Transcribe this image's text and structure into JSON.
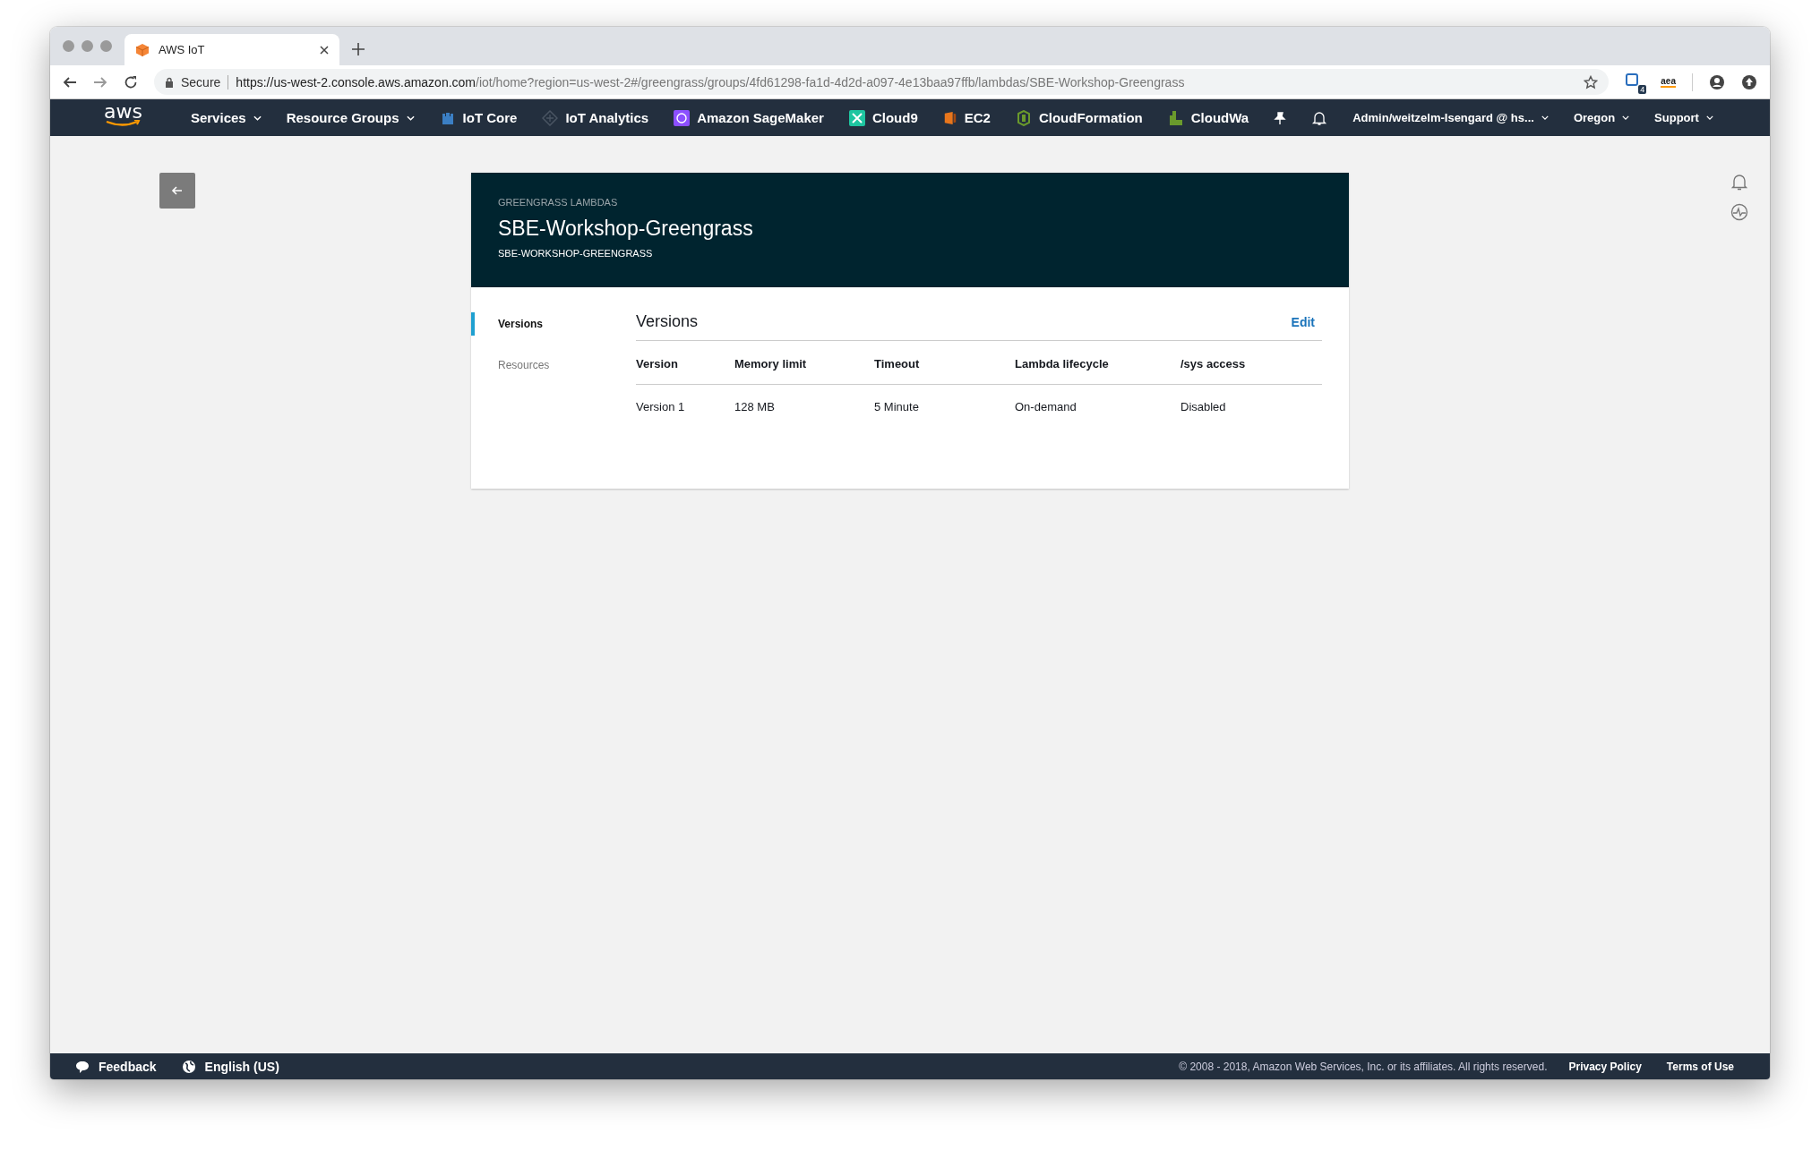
{
  "browser": {
    "tab_title": "AWS IoT",
    "secure_label": "Secure",
    "url_host": "https://us-west-2.console.aws.amazon.com",
    "url_path": "/iot/home?region=us-west-2#/greengrass/groups/4fd61298-fa1d-4d2d-a097-4e13baa97ffb/lambdas/SBE-Workshop-Greengrass",
    "extension_badge": "4",
    "extension_label": "aea"
  },
  "nav": {
    "logo": "aws",
    "menus": [
      {
        "label": "Services"
      },
      {
        "label": "Resource Groups"
      }
    ],
    "shortcuts": [
      {
        "label": "IoT Core",
        "kind": "iot-core"
      },
      {
        "label": "IoT Analytics",
        "kind": "iot-analytics"
      },
      {
        "label": "Amazon SageMaker",
        "kind": "sagemaker"
      },
      {
        "label": "Cloud9",
        "kind": "cloud9"
      },
      {
        "label": "EC2",
        "kind": "ec2"
      },
      {
        "label": "CloudFormation",
        "kind": "cloudformation"
      },
      {
        "label": "CloudWa",
        "kind": "cloudwatch"
      }
    ],
    "account": "Admin/weitzelm-Isengard @ hs...",
    "region": "Oregon",
    "support": "Support"
  },
  "header": {
    "eyebrow": "GREENGRASS LAMBDAS",
    "title": "SBE-Workshop-Greengrass",
    "subtitle": "SBE-WORKSHOP-GREENGRASS"
  },
  "tabs": [
    {
      "label": "Versions",
      "selected": true
    },
    {
      "label": "Resources",
      "selected": false
    }
  ],
  "section": {
    "title": "Versions",
    "action": "Edit"
  },
  "table": {
    "columns": [
      "Version",
      "Memory limit",
      "Timeout",
      "Lambda lifecycle",
      "/sys access"
    ],
    "rows": [
      [
        "Version 1",
        "128 MB",
        "5 Minute",
        "On-demand",
        "Disabled"
      ]
    ]
  },
  "footer": {
    "feedback": "Feedback",
    "language": "English (US)",
    "copyright": "© 2008 - 2018, Amazon Web Services, Inc. or its affiliates. All rights reserved.",
    "links": [
      "Privacy Policy",
      "Terms of Use"
    ]
  }
}
